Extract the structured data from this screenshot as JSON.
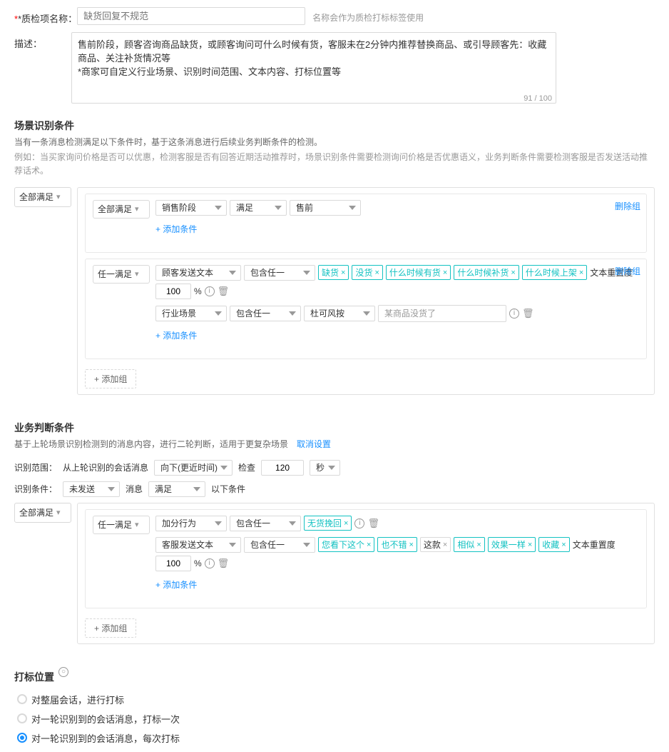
{
  "form": {
    "name_label": "*质检项名称：",
    "name_placeholder": "缺货回复不规范",
    "name_hint": "名称会作为质检打标标签使用",
    "desc_label": "描述：",
    "desc_value": "售前阶段，顾客咨询商品缺货，或顾客询问可什么时候有货，客服未在2分钟内推荐替换商品、或引导顾客先：收藏商品、关注补货情况等\n*商家可自定义行业场景、识别时间范围、文本内容、打标位置等",
    "desc_char_count": "91 / 100"
  },
  "scene_section": {
    "title": "场景识别条件",
    "desc_line1": "当有一条消息检测满足以下条件时，基于这条消息进行后续业务判断条件的检测。",
    "desc_line2": "例如：当买家询问价格是否可以优惠，检测客服是否有回答近期活动推荐时，场景识别条件需要检测询问价格是否优惠语义，业务判断条件需要检测客服是否发送活动推荐话术。",
    "outer_satisfy": "全部满足",
    "group1": {
      "satisfy": "全部满足",
      "delete_label": "删除组",
      "conditions": [
        {
          "type": "销售阶段",
          "op": "满足",
          "value": "售前"
        }
      ]
    },
    "group2": {
      "satisfy": "任一满足",
      "delete_label": "删除组",
      "conditions": [
        {
          "type": "顾客发送文本",
          "op": "包含任一",
          "tags": [
            "缺货",
            "没货",
            "什么时候有货",
            "什么时候补货",
            "什么时候上架"
          ],
          "similarity": "文本重置度",
          "percent": "100",
          "percent_symbol": "%"
        },
        {
          "type": "行业场景",
          "op": "包含任一",
          "value": "杜可风按",
          "text_value": "某商品没货了"
        }
      ]
    },
    "add_condition": "+ 添加条件",
    "add_group": "+ 添加组"
  },
  "business_section": {
    "title": "业务判断条件",
    "desc": "基于上轮场景识别检测到的消息内容，进行二轮判断，适用于更复杂场景",
    "cancel_label": "取消设置",
    "scope_label": "识别范围：",
    "scope_from": "从上轮识别的会话消息",
    "scope_direction": "向下(更近时间)",
    "scope_check_label": "检查",
    "scope_check_value": "120",
    "scope_unit": "秒",
    "condition_label": "识别条件：",
    "condition_status": "未发送",
    "condition_type": "消息",
    "condition_op": "满足",
    "condition_suffix": "以下条件",
    "outer_satisfy": "全部满足",
    "group": {
      "satisfy": "任一满足",
      "conditions": [
        {
          "type": "加分行为",
          "op": "包含任一",
          "tags": [
            "无货挽回"
          ],
          "has_percent": false
        },
        {
          "type": "客服发送文本",
          "op": "包含任一",
          "tags": [
            "您看下这个",
            "也不错",
            "这款",
            "相似",
            "效果一样",
            "收藏"
          ],
          "similarity": "文本重置度",
          "percent": "100",
          "percent_symbol": "%"
        }
      ],
      "add_condition": "+ 添加条件"
    },
    "add_group": "+ 添加组"
  },
  "tag_section": {
    "title": "打标位置",
    "options": [
      {
        "label": "对整届会话，进行打标",
        "checked": false
      },
      {
        "label": "对一轮识别到的会话消息，打标一次",
        "checked": false
      },
      {
        "label": "对一轮识别到的会话消息，每次打标",
        "checked": true
      }
    ]
  },
  "icons": {
    "chevron": "▾",
    "close": "×",
    "add": "+",
    "info": "i",
    "trash": "🗑",
    "circle_info": "○"
  }
}
